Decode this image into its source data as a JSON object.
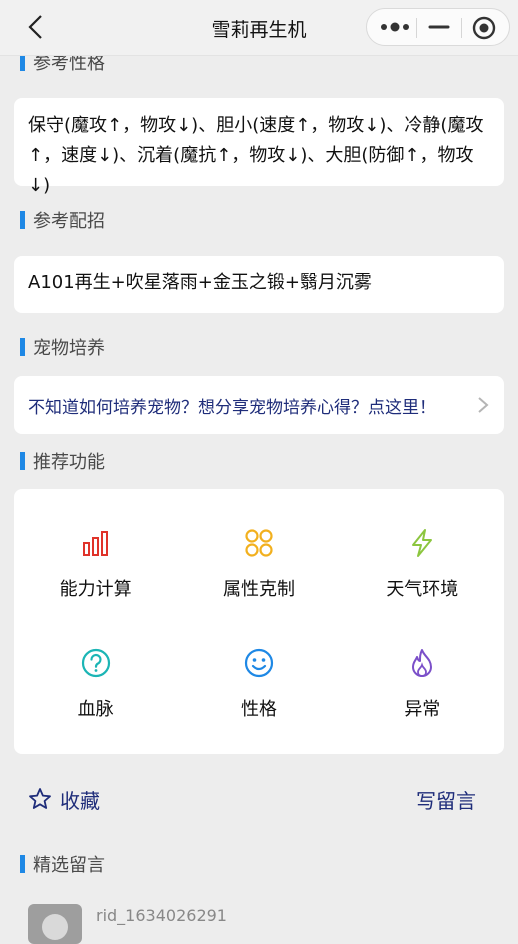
{
  "navbar": {
    "title": "雪莉再生机"
  },
  "sections": {
    "nature_title": "参考性格",
    "nature_text": "保守(魔攻↑，物攻↓)、胆小(速度↑，物攻↓)、冷静(魔攻↑，速度↓)、沉着(魔抗↑，物攻↓)、大胆(防御↑，物攻↓)",
    "moves_title": "参考配招",
    "moves_text": "A101再生+吹星落雨+金玉之锻+翳月沉雾",
    "training_title": "宠物培养",
    "training_link": "不知道如何培养宠物？想分享宠物培养心得？点这里！",
    "recommend_title": "推荐功能",
    "features": [
      {
        "label": "能力计算",
        "icon": "bar-chart-icon",
        "color": "#e0332a"
      },
      {
        "label": "属性克制",
        "icon": "grid-circles-icon",
        "color": "#f2b01e"
      },
      {
        "label": "天气环境",
        "icon": "lightning-icon",
        "color": "#8cc63f"
      },
      {
        "label": "血脉",
        "icon": "question-circle-icon",
        "color": "#1bb5b5"
      },
      {
        "label": "性格",
        "icon": "smile-icon",
        "color": "#1e88e5"
      },
      {
        "label": "异常",
        "icon": "flame-icon",
        "color": "#7b4fc9"
      }
    ]
  },
  "actions": {
    "favorite_label": "收藏",
    "comment_label": "写留言"
  },
  "comments": {
    "title": "精选留言",
    "first_user": "rid_1634026291"
  },
  "colors": {
    "accent": "#1e88e5",
    "link": "#1f2d7a"
  }
}
